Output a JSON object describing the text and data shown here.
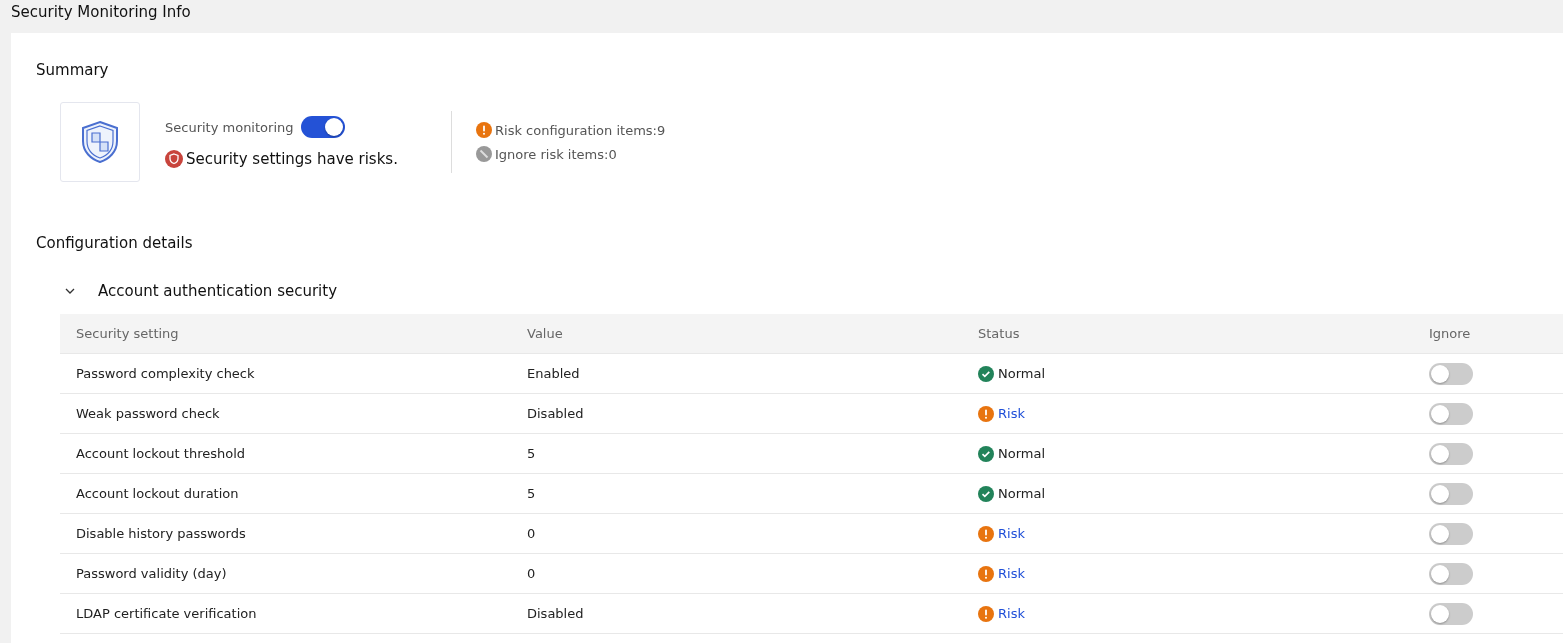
{
  "page_title": "Security Monitoring Info",
  "summary": {
    "heading": "Summary",
    "monitoring_label": "Security monitoring",
    "monitoring_on": true,
    "status": {
      "kind": "risk",
      "text": "Security settings have risks."
    },
    "counts": [
      {
        "kind": "risk",
        "label": "Risk configuration items:9"
      },
      {
        "kind": "ignored",
        "label": "Ignore risk items:0"
      }
    ]
  },
  "details": {
    "heading": "Configuration details",
    "group": {
      "title": "Account authentication security",
      "expanded": true,
      "columns": [
        "Security setting",
        "Value",
        "Status",
        "Ignore"
      ],
      "rows": [
        {
          "kind": "normal",
          "setting": "Password complexity check",
          "value": "Enabled",
          "status": "Normal",
          "ignore": false
        },
        {
          "kind": "risk",
          "setting": "Weak password check",
          "value": "Disabled",
          "status": "Risk",
          "ignore": false
        },
        {
          "kind": "normal",
          "setting": "Account lockout threshold",
          "value": "5",
          "status": "Normal",
          "ignore": false
        },
        {
          "kind": "normal",
          "setting": "Account lockout duration",
          "value": "5",
          "status": "Normal",
          "ignore": false
        },
        {
          "kind": "risk",
          "setting": "Disable history passwords",
          "value": "0",
          "status": "Risk",
          "ignore": false
        },
        {
          "kind": "risk",
          "setting": "Password validity (day)",
          "value": "0",
          "status": "Risk",
          "ignore": false
        },
        {
          "kind": "risk",
          "setting": "LDAP certificate verification",
          "value": "Disabled",
          "status": "Risk",
          "ignore": false
        }
      ]
    }
  }
}
